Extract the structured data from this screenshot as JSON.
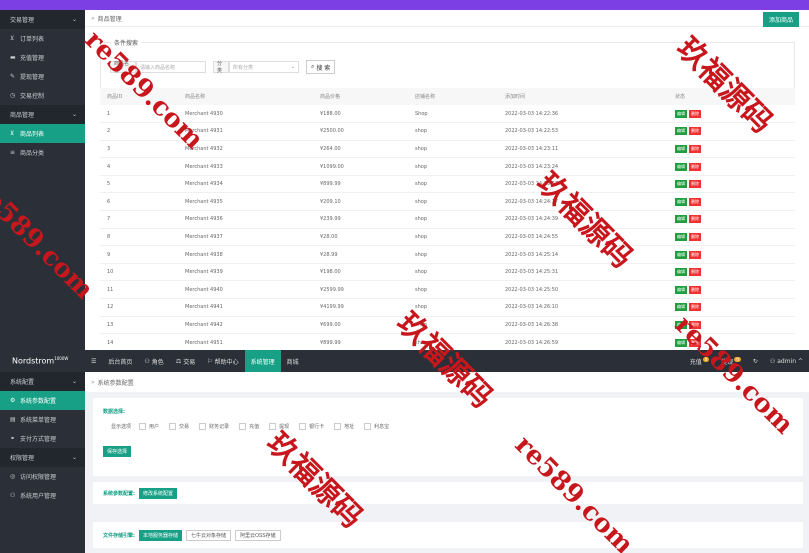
{
  "top": {
    "sidebar": [
      {
        "label": "交易管理",
        "group": true,
        "icon": ""
      },
      {
        "label": "订单列表",
        "icon": "cart-icon"
      },
      {
        "label": "充值管理",
        "icon": "card-icon"
      },
      {
        "label": "提现管理",
        "icon": "wrench-icon"
      },
      {
        "label": "交易控制",
        "icon": "clock-icon"
      },
      {
        "label": "商品管理",
        "group": true,
        "icon": ""
      },
      {
        "label": "商品列表",
        "active": true,
        "icon": "cart-icon"
      },
      {
        "label": "商品分类",
        "icon": "list-icon"
      }
    ],
    "breadcrumb": "商品管理",
    "add_button": "添加商品",
    "filter": {
      "title": "条件搜索",
      "name_label": "商品名称",
      "name_placeholder": "请输入商品名称",
      "category_label": "分类",
      "category_placeholder": "所有分类",
      "search_button": "搜 索"
    },
    "table": {
      "headers": [
        "商品ID",
        "商品名称",
        "商品价格",
        "店铺名称",
        "添加时间",
        "状态"
      ],
      "edit_label": "编辑",
      "delete_label": "删除",
      "rows": [
        [
          "1",
          "Merchant 4930",
          "¥188.00",
          "Shop",
          "2022-03-03 14:22:36"
        ],
        [
          "2",
          "Merchant 4931",
          "¥2500.00",
          "shop",
          "2022-03-03 14:22:53"
        ],
        [
          "3",
          "Merchant 4932",
          "¥264.00",
          "shop",
          "2022-03-03 14:23:11"
        ],
        [
          "4",
          "Merchant 4933",
          "¥1099.00",
          "shop",
          "2022-03-03 14:23:24"
        ],
        [
          "5",
          "Merchant 4934",
          "¥899.99",
          "shop",
          "2022-03-03 14:23:57"
        ],
        [
          "6",
          "Merchant 4935",
          "¥209.10",
          "shop",
          "2022-03-03 14:24:17"
        ],
        [
          "7",
          "Merchant 4936",
          "¥239.99",
          "shop",
          "2022-03-03 14:24:39"
        ],
        [
          "8",
          "Merchant 4937",
          "¥28.00",
          "shop",
          "2022-03-03 14:24:55"
        ],
        [
          "9",
          "Merchant 4938",
          "¥28.99",
          "shop",
          "2022-03-03 14:25:14"
        ],
        [
          "10",
          "Merchant 4939",
          "¥198.00",
          "shop",
          "2022-03-03 14:25:31"
        ],
        [
          "11",
          "Merchant 4940",
          "¥2599.99",
          "shop",
          "2022-03-03 14:25:50"
        ],
        [
          "12",
          "Merchant 4941",
          "¥4199.99",
          "shop",
          "2022-03-03 14:26:10"
        ],
        [
          "13",
          "Merchant 4942",
          "¥699.00",
          "shop",
          "2022-03-03 14:26:38"
        ],
        [
          "14",
          "Merchant 4951",
          "¥899.99",
          "shop",
          "2022-03-03 14:26:59"
        ]
      ]
    }
  },
  "nav": {
    "brand": "Nordstrom",
    "brand_sup": "1000W",
    "items": [
      "后台首页",
      "角色",
      "交易",
      "帮助中心",
      "系统管理",
      "商城"
    ],
    "active_index": 4,
    "recharge": "充值",
    "recharge_badge": "0",
    "withdraw": "提现",
    "withdraw_badge": "0",
    "user": "admin"
  },
  "bottom": {
    "sidebar": [
      {
        "label": "系统配置",
        "group": true
      },
      {
        "label": "系统参数配置",
        "active": true,
        "icon": "gear-icon"
      },
      {
        "label": "系统菜单管理",
        "icon": "menu-icon"
      },
      {
        "label": "支付方式管理",
        "icon": "link-icon"
      },
      {
        "label": "权限管理",
        "group": true
      },
      {
        "label": "访问权限管理",
        "icon": "shield-icon"
      },
      {
        "label": "系统用户管理",
        "icon": "user-icon"
      }
    ],
    "breadcrumb": "系统参数配置",
    "display": {
      "label": "数据选择:",
      "prefix": "显示选项",
      "options": [
        "用户",
        "交易",
        "财务记录",
        "充值",
        "提现",
        "银行卡",
        "地址",
        "利息宝"
      ],
      "save_button": "保存选择"
    },
    "env": {
      "label": "系统参数配置:",
      "button": "修改系统配置"
    },
    "storage": {
      "label": "文件存储引擎:",
      "options": [
        "本地服务器存储",
        "七牛云对象存储",
        "阿里云OSS存储"
      ]
    }
  },
  "watermark": {
    "text_cn": "玖福源码",
    "text_en": "re589.com"
  }
}
